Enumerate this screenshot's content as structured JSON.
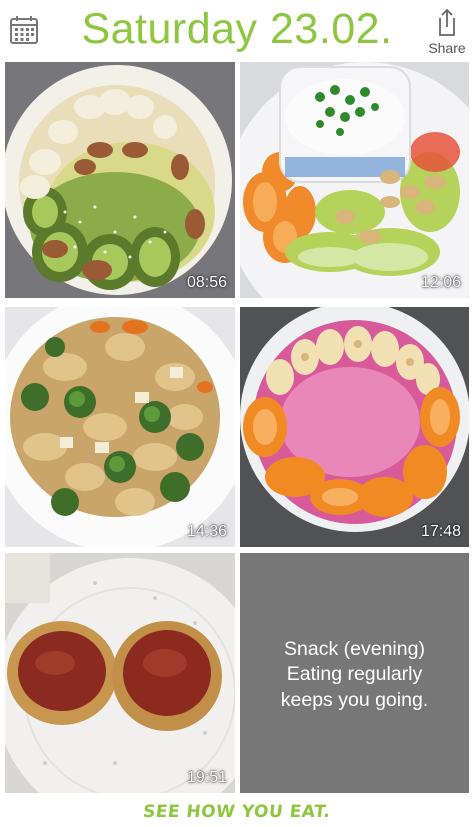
{
  "header": {
    "date_title": "Saturday 23.02.",
    "share_label": "Share",
    "calendar_icon": "calendar-icon",
    "share_icon": "share-icon"
  },
  "entries": [
    {
      "time": "08:56",
      "content": "bowl with kiwi, banana, almonds and coconut"
    },
    {
      "time": "12:06",
      "content": "plate with yogurt, chives, apple, cashews and orange"
    },
    {
      "time": "14:36",
      "content": "plate with farfalle pasta, broccoli and tofu"
    },
    {
      "time": "17:48",
      "content": "bowl with pink yogurt, banana and mandarin"
    },
    {
      "time": "19:51",
      "content": "plate with two toasts with jam"
    }
  ],
  "snack_tile": {
    "line1": "Snack (evening)",
    "line2": "Eating regularly",
    "line3": "keeps you going."
  },
  "footer": {
    "slogan": "SEE HOW YOU EAT."
  },
  "colors": {
    "accent": "#8dc63f",
    "snack_bg": "#777777"
  }
}
